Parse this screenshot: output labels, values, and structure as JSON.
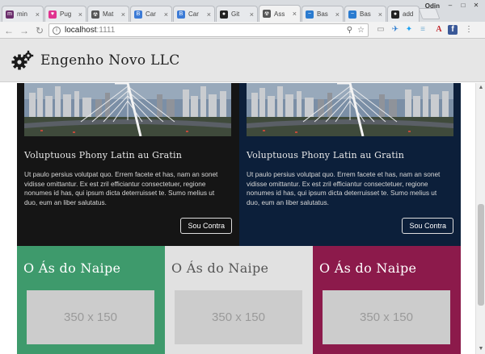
{
  "browser": {
    "tabs": [
      {
        "label": "min",
        "fav_color": "#6b2d6b",
        "fav_glyph": "m"
      },
      {
        "label": "Pug",
        "fav_color": "#e0338f",
        "fav_glyph": "♥"
      },
      {
        "label": "Mat",
        "fav_color": "#555555",
        "fav_glyph": "☢"
      },
      {
        "label": "Car",
        "fav_color": "#3c7bd6",
        "fav_glyph": "B"
      },
      {
        "label": "Car",
        "fav_color": "#3c7bd6",
        "fav_glyph": "B"
      },
      {
        "label": "Git",
        "fav_color": "#222222",
        "fav_glyph": "●"
      },
      {
        "label": "Ass",
        "fav_color": "#555555",
        "fav_glyph": "☢"
      },
      {
        "label": "Bas",
        "fav_color": "#2a7bd0",
        "fav_glyph": "~"
      },
      {
        "label": "Bas",
        "fav_color": "#2a7bd0",
        "fav_glyph": "~"
      },
      {
        "label": "add",
        "fav_color": "#222222",
        "fav_glyph": "●"
      }
    ],
    "active_tab_index": 6,
    "user_name": "Odin",
    "url_host": "localhost",
    "url_port": ":1111",
    "back_icon": "arrow-left-icon",
    "forward_icon": "arrow-right-icon",
    "reload_icon": "reload-icon",
    "home_icon": "home-icon",
    "window_minimize": "–",
    "window_maximize": "□",
    "window_close": "✕"
  },
  "header": {
    "title": "Engenho Novo LLC",
    "logo_icon": "gears-icon"
  },
  "cards": [
    {
      "title": "Voluptuous Phony Latin au Gratin",
      "body": "Ut paulo persius volutpat quo. Errem facete et has, nam an sonet vidisse omittantur. Ex est zril efficiantur consectetuer, regione nonumes id has, qui ipsum dicta deterruisset te. Sumo melius ut duo, eum an liber salutatus.",
      "button_label": "Sou Contra"
    },
    {
      "title": "Voluptuous Phony Latin au Gratin",
      "body": "Ut paulo persius volutpat quo. Errem facete et has, nam an sonet vidisse omittantur. Ex est zril efficiantur consectetuer, regione nonumes id has, qui ipsum dicta deterruisset te. Sumo melius ut duo, eum an liber salutatus.",
      "button_label": "Sou Contra"
    }
  ],
  "tiles": [
    {
      "title": "O Ás do Naipe",
      "placeholder": "350 x 150",
      "bg": "#3e9a6c"
    },
    {
      "title": "O Ás do Naipe",
      "placeholder": "350 x 150",
      "bg": "#e1e1e1"
    },
    {
      "title": "O Ás do Naipe",
      "placeholder": "350 x 150",
      "bg": "#8c1a4b"
    }
  ]
}
